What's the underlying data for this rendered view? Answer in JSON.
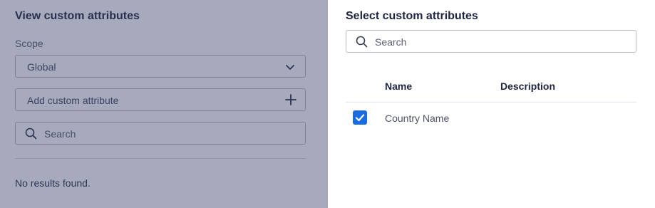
{
  "left_panel": {
    "title": "View custom attributes",
    "scope_label": "Scope",
    "scope_value": "Global",
    "add_placeholder": "Add custom attribute",
    "search_placeholder": "Search",
    "empty_message": "No results found."
  },
  "right_panel": {
    "title": "Select custom attributes",
    "search_placeholder": "Search",
    "columns": {
      "name": "Name",
      "description": "Description"
    },
    "rows": [
      {
        "name": "Country Name",
        "description": "",
        "checked": true
      }
    ]
  },
  "colors": {
    "overlay": "#a7a9bd",
    "checkbox": "#1a6de0"
  },
  "icons": {
    "scope_chevron": "chevron-down-icon",
    "add": "plus-icon",
    "search": "search-icon",
    "checkbox": "checkmark-icon"
  }
}
